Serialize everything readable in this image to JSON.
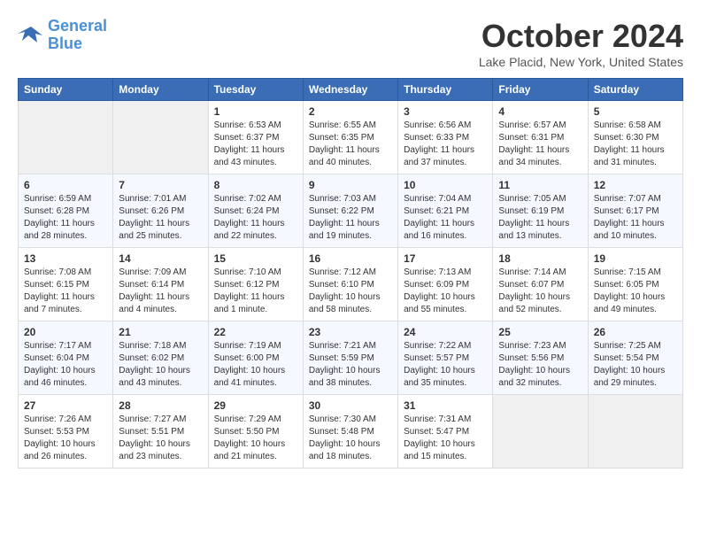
{
  "logo": {
    "line1": "General",
    "line2": "Blue"
  },
  "title": "October 2024",
  "location": "Lake Placid, New York, United States",
  "days_of_week": [
    "Sunday",
    "Monday",
    "Tuesday",
    "Wednesday",
    "Thursday",
    "Friday",
    "Saturday"
  ],
  "weeks": [
    [
      {
        "day": "",
        "sunrise": "",
        "sunset": "",
        "daylight": ""
      },
      {
        "day": "",
        "sunrise": "",
        "sunset": "",
        "daylight": ""
      },
      {
        "day": "1",
        "sunrise": "Sunrise: 6:53 AM",
        "sunset": "Sunset: 6:37 PM",
        "daylight": "Daylight: 11 hours and 43 minutes."
      },
      {
        "day": "2",
        "sunrise": "Sunrise: 6:55 AM",
        "sunset": "Sunset: 6:35 PM",
        "daylight": "Daylight: 11 hours and 40 minutes."
      },
      {
        "day": "3",
        "sunrise": "Sunrise: 6:56 AM",
        "sunset": "Sunset: 6:33 PM",
        "daylight": "Daylight: 11 hours and 37 minutes."
      },
      {
        "day": "4",
        "sunrise": "Sunrise: 6:57 AM",
        "sunset": "Sunset: 6:31 PM",
        "daylight": "Daylight: 11 hours and 34 minutes."
      },
      {
        "day": "5",
        "sunrise": "Sunrise: 6:58 AM",
        "sunset": "Sunset: 6:30 PM",
        "daylight": "Daylight: 11 hours and 31 minutes."
      }
    ],
    [
      {
        "day": "6",
        "sunrise": "Sunrise: 6:59 AM",
        "sunset": "Sunset: 6:28 PM",
        "daylight": "Daylight: 11 hours and 28 minutes."
      },
      {
        "day": "7",
        "sunrise": "Sunrise: 7:01 AM",
        "sunset": "Sunset: 6:26 PM",
        "daylight": "Daylight: 11 hours and 25 minutes."
      },
      {
        "day": "8",
        "sunrise": "Sunrise: 7:02 AM",
        "sunset": "Sunset: 6:24 PM",
        "daylight": "Daylight: 11 hours and 22 minutes."
      },
      {
        "day": "9",
        "sunrise": "Sunrise: 7:03 AM",
        "sunset": "Sunset: 6:22 PM",
        "daylight": "Daylight: 11 hours and 19 minutes."
      },
      {
        "day": "10",
        "sunrise": "Sunrise: 7:04 AM",
        "sunset": "Sunset: 6:21 PM",
        "daylight": "Daylight: 11 hours and 16 minutes."
      },
      {
        "day": "11",
        "sunrise": "Sunrise: 7:05 AM",
        "sunset": "Sunset: 6:19 PM",
        "daylight": "Daylight: 11 hours and 13 minutes."
      },
      {
        "day": "12",
        "sunrise": "Sunrise: 7:07 AM",
        "sunset": "Sunset: 6:17 PM",
        "daylight": "Daylight: 11 hours and 10 minutes."
      }
    ],
    [
      {
        "day": "13",
        "sunrise": "Sunrise: 7:08 AM",
        "sunset": "Sunset: 6:15 PM",
        "daylight": "Daylight: 11 hours and 7 minutes."
      },
      {
        "day": "14",
        "sunrise": "Sunrise: 7:09 AM",
        "sunset": "Sunset: 6:14 PM",
        "daylight": "Daylight: 11 hours and 4 minutes."
      },
      {
        "day": "15",
        "sunrise": "Sunrise: 7:10 AM",
        "sunset": "Sunset: 6:12 PM",
        "daylight": "Daylight: 11 hours and 1 minute."
      },
      {
        "day": "16",
        "sunrise": "Sunrise: 7:12 AM",
        "sunset": "Sunset: 6:10 PM",
        "daylight": "Daylight: 10 hours and 58 minutes."
      },
      {
        "day": "17",
        "sunrise": "Sunrise: 7:13 AM",
        "sunset": "Sunset: 6:09 PM",
        "daylight": "Daylight: 10 hours and 55 minutes."
      },
      {
        "day": "18",
        "sunrise": "Sunrise: 7:14 AM",
        "sunset": "Sunset: 6:07 PM",
        "daylight": "Daylight: 10 hours and 52 minutes."
      },
      {
        "day": "19",
        "sunrise": "Sunrise: 7:15 AM",
        "sunset": "Sunset: 6:05 PM",
        "daylight": "Daylight: 10 hours and 49 minutes."
      }
    ],
    [
      {
        "day": "20",
        "sunrise": "Sunrise: 7:17 AM",
        "sunset": "Sunset: 6:04 PM",
        "daylight": "Daylight: 10 hours and 46 minutes."
      },
      {
        "day": "21",
        "sunrise": "Sunrise: 7:18 AM",
        "sunset": "Sunset: 6:02 PM",
        "daylight": "Daylight: 10 hours and 43 minutes."
      },
      {
        "day": "22",
        "sunrise": "Sunrise: 7:19 AM",
        "sunset": "Sunset: 6:00 PM",
        "daylight": "Daylight: 10 hours and 41 minutes."
      },
      {
        "day": "23",
        "sunrise": "Sunrise: 7:21 AM",
        "sunset": "Sunset: 5:59 PM",
        "daylight": "Daylight: 10 hours and 38 minutes."
      },
      {
        "day": "24",
        "sunrise": "Sunrise: 7:22 AM",
        "sunset": "Sunset: 5:57 PM",
        "daylight": "Daylight: 10 hours and 35 minutes."
      },
      {
        "day": "25",
        "sunrise": "Sunrise: 7:23 AM",
        "sunset": "Sunset: 5:56 PM",
        "daylight": "Daylight: 10 hours and 32 minutes."
      },
      {
        "day": "26",
        "sunrise": "Sunrise: 7:25 AM",
        "sunset": "Sunset: 5:54 PM",
        "daylight": "Daylight: 10 hours and 29 minutes."
      }
    ],
    [
      {
        "day": "27",
        "sunrise": "Sunrise: 7:26 AM",
        "sunset": "Sunset: 5:53 PM",
        "daylight": "Daylight: 10 hours and 26 minutes."
      },
      {
        "day": "28",
        "sunrise": "Sunrise: 7:27 AM",
        "sunset": "Sunset: 5:51 PM",
        "daylight": "Daylight: 10 hours and 23 minutes."
      },
      {
        "day": "29",
        "sunrise": "Sunrise: 7:29 AM",
        "sunset": "Sunset: 5:50 PM",
        "daylight": "Daylight: 10 hours and 21 minutes."
      },
      {
        "day": "30",
        "sunrise": "Sunrise: 7:30 AM",
        "sunset": "Sunset: 5:48 PM",
        "daylight": "Daylight: 10 hours and 18 minutes."
      },
      {
        "day": "31",
        "sunrise": "Sunrise: 7:31 AM",
        "sunset": "Sunset: 5:47 PM",
        "daylight": "Daylight: 10 hours and 15 minutes."
      },
      {
        "day": "",
        "sunrise": "",
        "sunset": "",
        "daylight": ""
      },
      {
        "day": "",
        "sunrise": "",
        "sunset": "",
        "daylight": ""
      }
    ]
  ]
}
